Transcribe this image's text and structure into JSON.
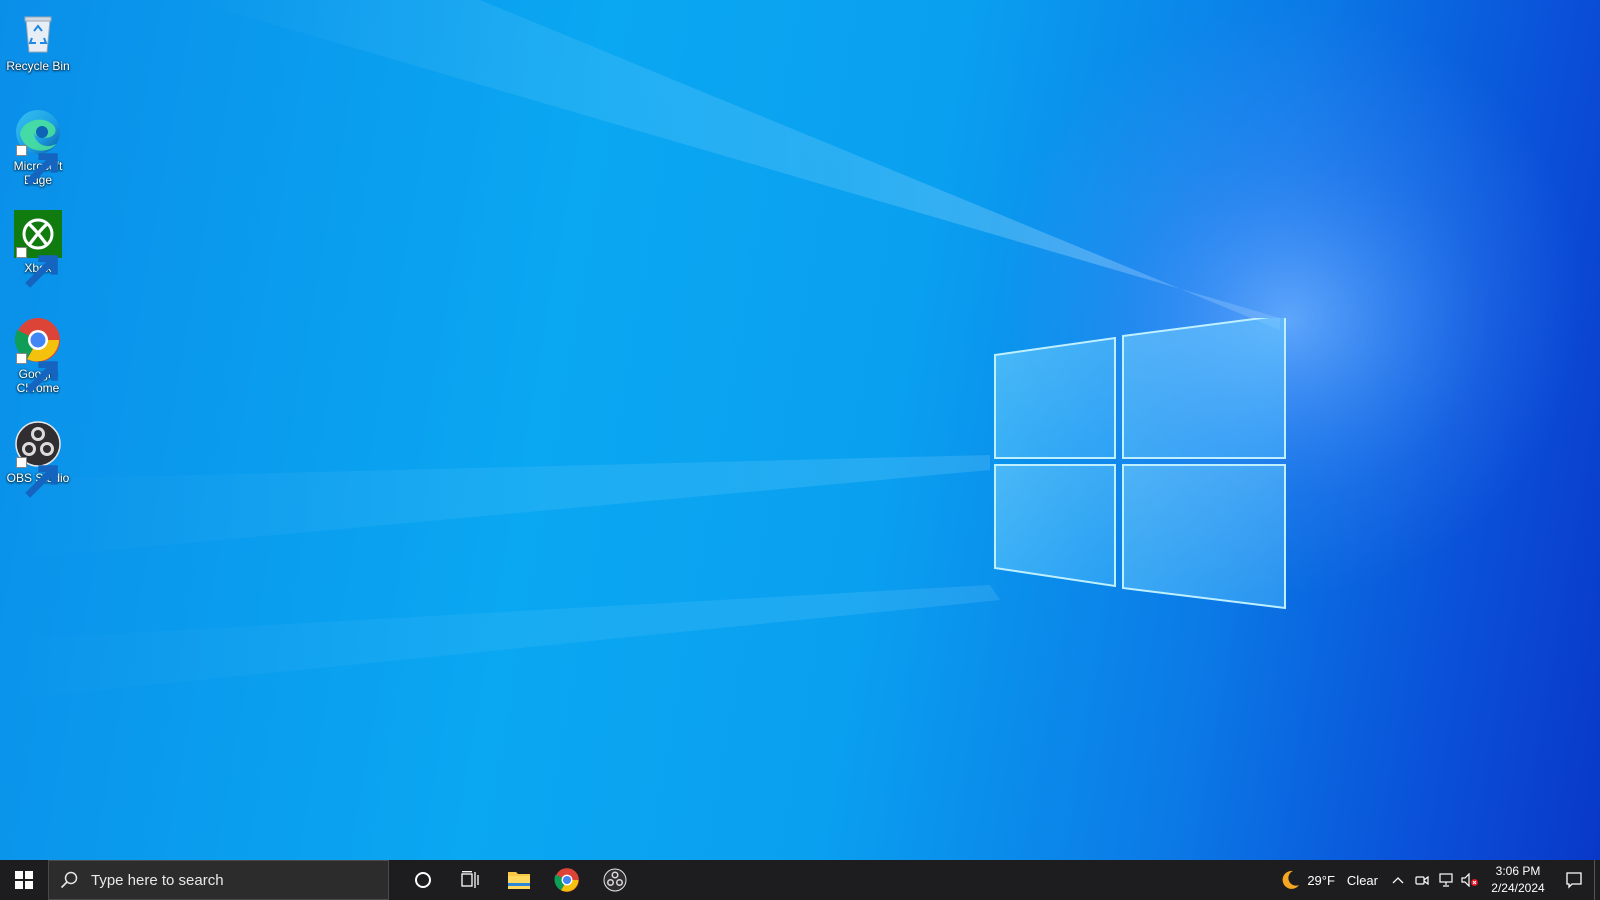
{
  "desktop": {
    "icons": [
      {
        "label": "Recycle Bin",
        "icon": "recycle-bin-icon"
      },
      {
        "label": "Microsoft Edge",
        "icon": "edge-icon"
      },
      {
        "label": "Xbox",
        "icon": "xbox-icon"
      },
      {
        "label": "Google Chrome",
        "icon": "chrome-icon"
      },
      {
        "label": "OBS Studio",
        "icon": "obs-icon"
      }
    ]
  },
  "taskbar": {
    "search_placeholder": "Type here to search",
    "pinned": [
      "cortana-icon",
      "task-view-icon",
      "file-explorer-icon",
      "chrome-icon",
      "obs-icon"
    ],
    "weather": {
      "temp": "29°F",
      "condition": "Clear"
    },
    "clock": {
      "time": "3:06 PM",
      "date": "2/24/2024"
    }
  },
  "colors": {
    "taskbar_bg": "#1d1d1f",
    "wallpaper_accent": "#0aa7f2"
  }
}
